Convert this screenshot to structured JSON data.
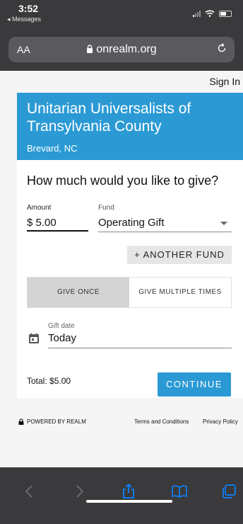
{
  "status_bar": {
    "time": "3:52",
    "back_app": "◂ Messages"
  },
  "browser": {
    "text_size_label": "AA",
    "url": "onrealm.org"
  },
  "header": {
    "sign_in": "Sign In"
  },
  "organization": {
    "name": "Unitarian Universalists of Transylvania County",
    "location": "Brevard, NC"
  },
  "form": {
    "question": "How much would you like to give?",
    "amount_label": "Amount",
    "amount_value": "$ 5.00",
    "fund_label": "Fund",
    "fund_value": "Operating Gift",
    "another_fund_label": "+ ANOTHER FUND",
    "tabs": [
      {
        "label": "GIVE ONCE",
        "active": true
      },
      {
        "label": "GIVE MULTIPLE TIMES",
        "active": false
      }
    ],
    "gift_date_label": "Gift date",
    "gift_date_value": "Today",
    "total": "Total: $5.00",
    "continue_label": "CONTINUE"
  },
  "footer": {
    "powered_by": "POWERED BY REALM",
    "terms": "Terms and Conditions",
    "privacy": "Privacy Policy"
  },
  "colors": {
    "accent": "#2b9ad4",
    "chrome": "#3a3a3c",
    "toolbar_icon": "#0a84ff"
  }
}
